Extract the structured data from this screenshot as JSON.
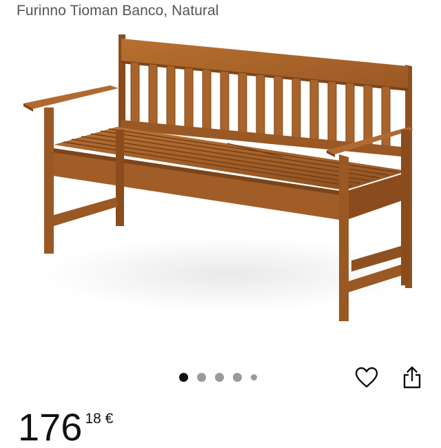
{
  "product": {
    "title": "Furinno Tioman Banco, Natural",
    "image_alt": "wooden-bench-photo"
  },
  "colors": {
    "wood_main": "#a5612b",
    "wood_dark": "#7c4419",
    "wood_light": "#c07a3f",
    "dot_active": "#111111",
    "dot_inactive": "#9a9a9a"
  },
  "carousel": {
    "count": 5,
    "active_index": 0
  },
  "actions": {
    "favorite_icon": "heart-icon",
    "share_icon": "share-icon"
  },
  "price": {
    "whole": "176",
    "fraction": "18 €"
  }
}
